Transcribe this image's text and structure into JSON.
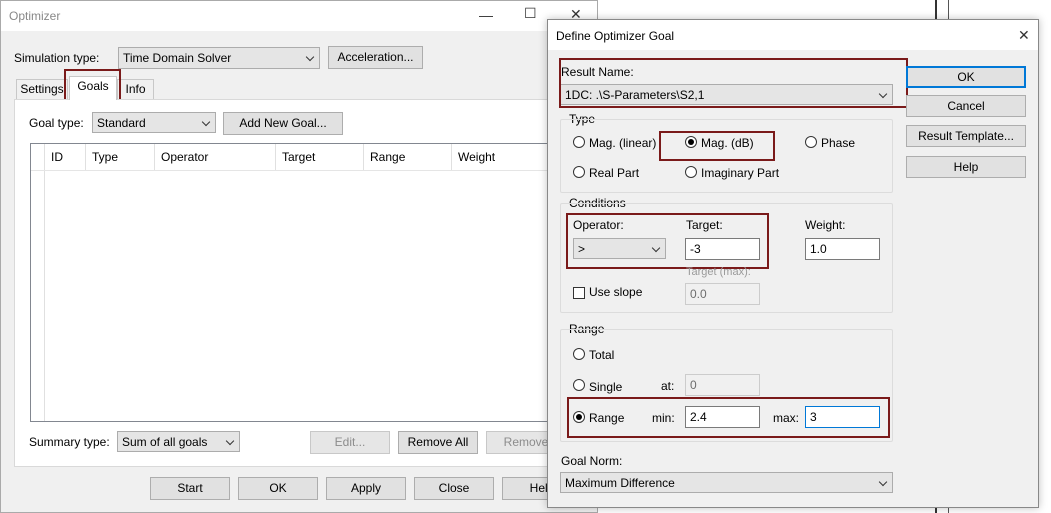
{
  "optimizer": {
    "title": "Optimizer",
    "simulation_type_label": "Simulation type:",
    "simulation_type_value": "Time Domain Solver",
    "acceleration_label": "Acceleration...",
    "tabs": [
      "Settings",
      "Goals",
      "Info"
    ],
    "goal_type_label": "Goal type:",
    "goal_type_value": "Standard",
    "add_goal_label": "Add New Goal...",
    "table_headers": [
      "ID",
      "Type",
      "Operator",
      "Target",
      "Range",
      "Weight"
    ],
    "summary_type_label": "Summary type:",
    "summary_type_value": "Sum of all goals",
    "edit_label": "Edit...",
    "remove_all_label": "Remove All",
    "remove_label": "Remove",
    "bottom_buttons": [
      "Start",
      "OK",
      "Apply",
      "Close",
      "Help"
    ]
  },
  "dialog": {
    "title": "Define Optimizer Goal",
    "result_name_label": "Result Name:",
    "result_name_value": "1DC: .\\S-Parameters\\S2,1",
    "type_group": "Type",
    "type_options": [
      "Mag. (linear)",
      "Mag. (dB)",
      "Phase",
      "Real Part",
      "Imaginary Part"
    ],
    "type_selected": "Mag. (dB)",
    "conditions_group": "Conditions",
    "operator_label": "Operator:",
    "operator_value": ">",
    "target_label": "Target:",
    "target_value": "-3",
    "weight_label": "Weight:",
    "weight_value": "1.0",
    "target_max_label": "Target (max):",
    "target_max_value": "0.0",
    "use_slope_label": "Use slope",
    "range_group": "Range",
    "range_total": "Total",
    "range_single": "Single",
    "at_label": "at:",
    "at_value": "0",
    "range_range": "Range",
    "min_label": "min:",
    "min_value": "2.4",
    "max_label": "max:",
    "max_value": "3",
    "goal_norm_label": "Goal Norm:",
    "goal_norm_value": "Maximum Difference",
    "ok_label": "OK",
    "cancel_label": "Cancel",
    "result_template_label": "Result Template...",
    "help_label": "Help"
  },
  "colors": {
    "highlight_box": "#7a1a1a",
    "focus_blue": "#0078d7",
    "window_bg": "#f0f0f0"
  }
}
